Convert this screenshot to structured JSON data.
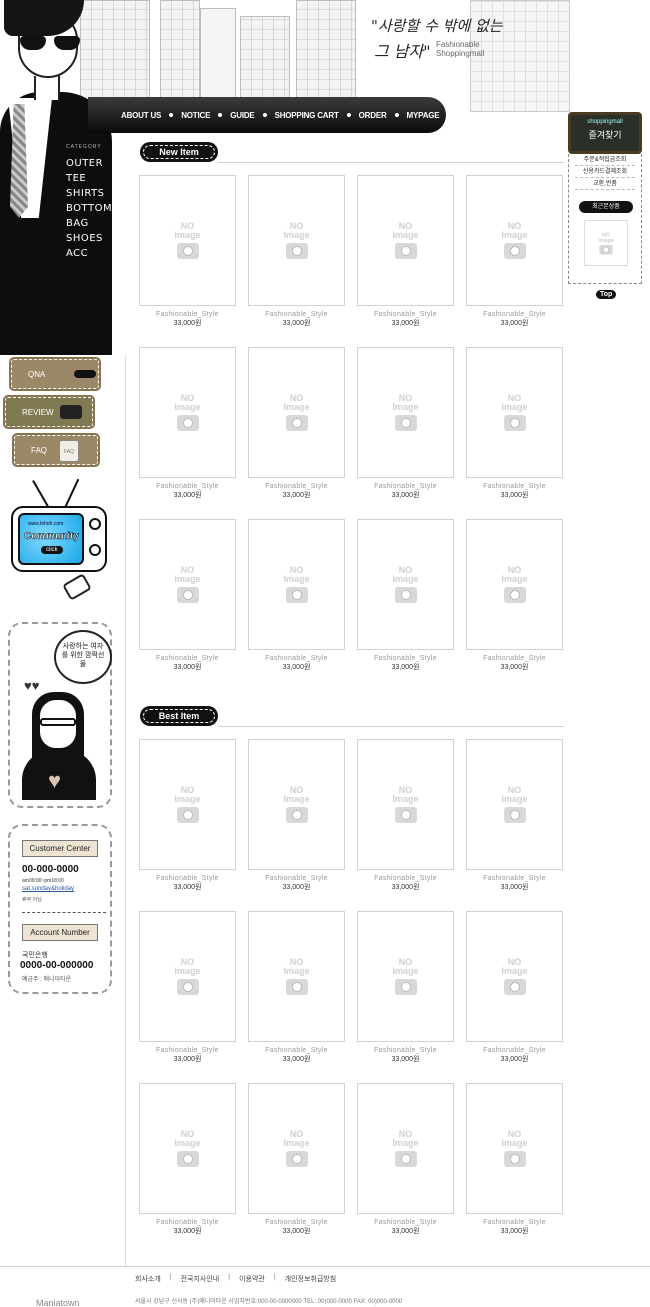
{
  "header": {
    "slogan_line1": "\"사랑할 수 밖에 없는",
    "slogan_line2": "그 남자\"",
    "brand_line1": "Fashionable",
    "brand_line2": "Shoppingmall"
  },
  "nav": {
    "items": [
      "ABOUT US",
      "NOTICE",
      "GUIDE",
      "SHOPPING CART",
      "ORDER",
      "MYPAGE"
    ]
  },
  "category": {
    "label": "CATEGORY",
    "items": [
      "OUTER",
      "TEE",
      "SHIRTS",
      "BOTTOM",
      "BAG",
      "SHOES",
      "ACC"
    ]
  },
  "side_buttons": {
    "qna": "QNA",
    "review": "REVIEW",
    "faq": "FAQ",
    "faq_card": "FAQ"
  },
  "community": {
    "url": "www.tohoh.com",
    "title": "Community",
    "click": "click"
  },
  "girl": {
    "bubble": "사랑하는 여자를 위한 깜짝선물"
  },
  "customer_center": {
    "title": "Customer Center",
    "phone": "00-000-0000",
    "hours": "am09:00~pm18:00",
    "days": "sat,sunday&holiday",
    "note": "휴무 아님",
    "account_title": "Account Number",
    "bank": "국민은행",
    "account_number": "0000-00-000000",
    "holder": "예금주 : 매니아타운"
  },
  "new_item": {
    "title": "New Item",
    "products": [
      {
        "name": "Fashionable_Style",
        "price": "33,000원"
      },
      {
        "name": "Fashionable_Style",
        "price": "33,000원"
      },
      {
        "name": "Fashionable_Style",
        "price": "33,000원"
      },
      {
        "name": "Fashionable_Style",
        "price": "33,000원"
      },
      {
        "name": "Fashionable_Style",
        "price": "33,000원"
      },
      {
        "name": "Fashionable_Style",
        "price": "33,000원"
      },
      {
        "name": "Fashionable_Style",
        "price": "33,000원"
      },
      {
        "name": "Fashionable_Style",
        "price": "33,000원"
      },
      {
        "name": "Fashionable_Style",
        "price": "33,000원"
      },
      {
        "name": "Fashionable_Style",
        "price": "33,000원"
      },
      {
        "name": "Fashionable_Style",
        "price": "33,000원"
      },
      {
        "name": "Fashionable_Style",
        "price": "33,000원"
      }
    ]
  },
  "best_item": {
    "title": "Best Item",
    "products": [
      {
        "name": "Fashionable_Style",
        "price": "33,000원"
      },
      {
        "name": "Fashionable_Style",
        "price": "33,000원"
      },
      {
        "name": "Fashionable_Style",
        "price": "33,000원"
      },
      {
        "name": "Fashionable_Style",
        "price": "33,000원"
      },
      {
        "name": "Fashionable_Style",
        "price": "33,000원"
      },
      {
        "name": "Fashionable_Style",
        "price": "33,000원"
      },
      {
        "name": "Fashionable_Style",
        "price": "33,000원"
      },
      {
        "name": "Fashionable_Style",
        "price": "33,000원"
      },
      {
        "name": "Fashionable_Style",
        "price": "33,000원"
      },
      {
        "name": "Fashionable_Style",
        "price": "33,000원"
      },
      {
        "name": "Fashionable_Style",
        "price": "33,000원"
      },
      {
        "name": "Fashionable_Style",
        "price": "33,000원"
      }
    ]
  },
  "no_image": {
    "line1": "NO",
    "line2": "Image"
  },
  "quick_menu": {
    "brand": "shoppingmall",
    "title": "즐겨찾기",
    "items": [
      "주문&적립금조회",
      "신용카드결제조회",
      "교환,반품"
    ],
    "recent": "최근본상품",
    "top": "Top"
  },
  "footer": {
    "links": [
      "회사소개",
      "전국지사안내",
      "이용약관",
      "개인정보취급방침"
    ],
    "logo": "Maniatown",
    "address": "서울시 강남구 신사동 (주)매니아타운   사업자번호:000-00-0000000   TEL: 00)000-0000   FAX: 00)000-0000"
  }
}
